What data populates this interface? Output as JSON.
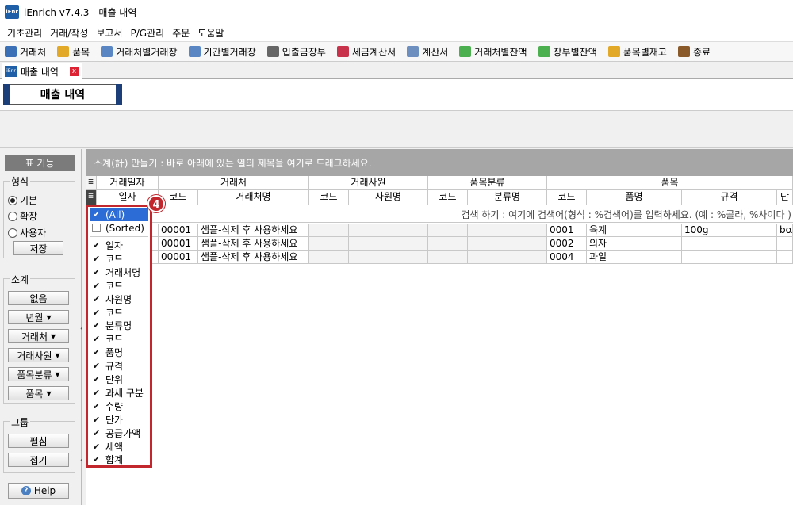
{
  "window": {
    "logo_text": "iEnr",
    "title": "iEnrich v7.4.3 - 매출 내역"
  },
  "menu": [
    "기초관리",
    "거래/작성",
    "보고서",
    "P/G관리",
    "주문",
    "도움말"
  ],
  "toolbar": [
    {
      "label": "거래처",
      "icon": "person-icon",
      "color": "#3b6fb6"
    },
    {
      "label": "품목",
      "icon": "box-icon",
      "color": "#e2a827"
    },
    {
      "label": "거래처별거래장",
      "icon": "ledger-icon",
      "color": "#5a86c4"
    },
    {
      "label": "기간별거래장",
      "icon": "ledger-icon",
      "color": "#5a86c4"
    },
    {
      "label": "입출금장부",
      "icon": "book-icon",
      "color": "#666666"
    },
    {
      "label": "세금계산서",
      "icon": "invoice-icon",
      "color": "#c8324a"
    },
    {
      "label": "계산서",
      "icon": "document-icon",
      "color": "#6d8fbf"
    },
    {
      "label": "거래처별잔액",
      "icon": "money-icon",
      "color": "#4caf50"
    },
    {
      "label": "장부별잔액",
      "icon": "money-icon",
      "color": "#4caf50"
    },
    {
      "label": "품목별재고",
      "icon": "box-icon",
      "color": "#e2a827"
    },
    {
      "label": "종료",
      "icon": "exit-icon",
      "color": "#8a5a2b"
    }
  ],
  "tab": {
    "label": "매출 내역",
    "close": "x"
  },
  "page_title": "매출 내역",
  "sidebar": {
    "function_header": "표 기능",
    "format_label": "형식",
    "formats": [
      {
        "label": "기본",
        "checked": true
      },
      {
        "label": "확장",
        "checked": false
      },
      {
        "label": "사용자",
        "checked": false
      }
    ],
    "save": "저장",
    "subtotal_label": "소계",
    "subtotal_buttons": [
      {
        "label": "없음",
        "caret": ""
      },
      {
        "label": "년월",
        "caret": "▼"
      },
      {
        "label": "거래처",
        "caret": "▼"
      },
      {
        "label": "거래사원",
        "caret": "▼"
      },
      {
        "label": "품목분류",
        "caret": "▼"
      },
      {
        "label": "품목",
        "caret": "▼"
      }
    ],
    "group_label": "그룹",
    "expand": "펼침",
    "collapse": "접기",
    "help": "Help",
    "collapse_arrow": "‹"
  },
  "grid": {
    "group_hint": "소계(計) 만들기 : 바로 아래에 있는 열의 제목을 여기로 드래그하세요.",
    "row_icon": "≣",
    "band_headers": [
      "거래일자",
      "거래처",
      "거래사원",
      "품목분류",
      "품목"
    ],
    "columns": [
      "일자",
      "코드",
      "거래처명",
      "코드",
      "사원명",
      "코드",
      "분류명",
      "코드",
      "품명",
      "규격",
      "단"
    ],
    "filter_hint": "검색 하기 : 여기에 검색어(형식 : %검색어)를 입력하세요. (예 : %콜라, %사이다 )",
    "rows": [
      [
        "",
        "00001",
        "샘플-삭제 후 사용하세요",
        "",
        "",
        "",
        "",
        "0001",
        "육계",
        "100g",
        "box"
      ],
      [
        "",
        "00001",
        "샘플-삭제 후 사용하세요",
        "",
        "",
        "",
        "",
        "0002",
        "의자",
        "",
        ""
      ],
      [
        "",
        "00001",
        "샘플-삭제 후 사용하세요",
        "",
        "",
        "",
        "",
        "0004",
        "과일",
        "",
        ""
      ]
    ]
  },
  "column_chooser": {
    "badge": "4",
    "check": "✔",
    "items": [
      {
        "label": "(All)",
        "checked": true,
        "selected": true
      },
      {
        "label": "(Sorted)",
        "checked": false,
        "selected": false
      },
      {
        "label": "일자",
        "checked": true
      },
      {
        "label": "코드",
        "checked": true
      },
      {
        "label": "거래처명",
        "checked": true
      },
      {
        "label": "코드",
        "checked": true
      },
      {
        "label": "사원명",
        "checked": true
      },
      {
        "label": "코드",
        "checked": true
      },
      {
        "label": "분류명",
        "checked": true
      },
      {
        "label": "코드",
        "checked": true
      },
      {
        "label": "품명",
        "checked": true
      },
      {
        "label": "규격",
        "checked": true
      },
      {
        "label": "단위",
        "checked": true
      },
      {
        "label": "과세 구분",
        "checked": true
      },
      {
        "label": "수량",
        "checked": true
      },
      {
        "label": "단가",
        "checked": true
      },
      {
        "label": "공급가액",
        "checked": true
      },
      {
        "label": "세액",
        "checked": true
      },
      {
        "label": "합계",
        "checked": true
      }
    ]
  }
}
